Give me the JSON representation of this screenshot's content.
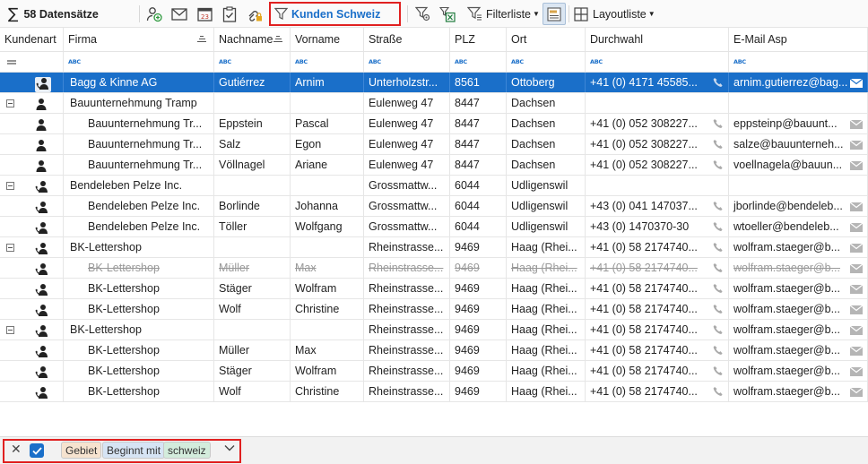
{
  "toolbar": {
    "record_count": "58 Datensätze",
    "active_filter": "Kunden Schweiz",
    "filter_list_label": "Filterliste",
    "layout_list_label": "Layoutliste"
  },
  "grid": {
    "columns": [
      "Kundenart",
      "Firma",
      "Nachname",
      "Vorname",
      "Straße",
      "PLZ",
      "Ort",
      "Durchwahl",
      "E-Mail Asp"
    ],
    "filter_placeholder": "ABC",
    "rows": [
      {
        "type": "detail",
        "icon": "person-phone",
        "firma": "Bagg & Kinne AG",
        "nachname": "Gutiérrez",
        "vorname": "Arnim",
        "strasse": "Unterholzstr...",
        "plz": "8561",
        "ort": "Ottoberg",
        "durchwahl": "+41 (0) 4171 45585...",
        "email": "arnim.gutierrez@bag...",
        "selected": true
      },
      {
        "type": "group",
        "icon": "person",
        "firma": "Bauunternehmung Tramp",
        "nachname": "",
        "vorname": "",
        "strasse": "Eulenweg 47",
        "plz": "8447",
        "ort": "Dachsen",
        "durchwahl": "",
        "email": ""
      },
      {
        "type": "detail",
        "icon": "person",
        "firma": "Bauunternehmung Tr...",
        "nachname": "Eppstein",
        "vorname": "Pascal",
        "strasse": "Eulenweg 47",
        "plz": "8447",
        "ort": "Dachsen",
        "durchwahl": "+41 (0) 052 308227...",
        "email": "eppsteinp@bauunt..."
      },
      {
        "type": "detail",
        "icon": "person",
        "firma": "Bauunternehmung Tr...",
        "nachname": "Salz",
        "vorname": "Egon",
        "strasse": "Eulenweg 47",
        "plz": "8447",
        "ort": "Dachsen",
        "durchwahl": "+41 (0) 052 308227...",
        "email": "salze@bauunterneh..."
      },
      {
        "type": "detail",
        "icon": "person",
        "firma": "Bauunternehmung Tr...",
        "nachname": "Völlnagel",
        "vorname": "Ariane",
        "strasse": "Eulenweg 47",
        "plz": "8447",
        "ort": "Dachsen",
        "durchwahl": "+41 (0) 052 308227...",
        "email": "voellnagela@bauun..."
      },
      {
        "type": "group",
        "icon": "person-phone",
        "firma": "Bendeleben Pelze Inc.",
        "nachname": "",
        "vorname": "",
        "strasse": "Grossmattw...",
        "plz": "6044",
        "ort": "Udligenswil",
        "durchwahl": "",
        "email": ""
      },
      {
        "type": "detail",
        "icon": "person-phone",
        "firma": "Bendeleben Pelze Inc.",
        "nachname": "Borlinde",
        "vorname": "Johanna",
        "strasse": "Grossmattw...",
        "plz": "6044",
        "ort": "Udligenswil",
        "durchwahl": "+43 (0) 041 147037...",
        "email": "jborlinde@bendeleb..."
      },
      {
        "type": "detail",
        "icon": "person-phone",
        "firma": "Bendeleben Pelze Inc.",
        "nachname": "Töller",
        "vorname": "Wolfgang",
        "strasse": "Grossmattw...",
        "plz": "6044",
        "ort": "Udligenswil",
        "durchwahl": "+43 (0) 1470370-30",
        "email": "wtoeller@bendeleb..."
      },
      {
        "type": "group",
        "icon": "person-phone",
        "firma": "BK-Lettershop",
        "nachname": "",
        "vorname": "",
        "strasse": "Rheinstrasse...",
        "plz": "9469",
        "ort": "Haag (Rhei...",
        "durchwahl": "+41 (0) 58 2174740...",
        "email": "wolfram.staeger@b..."
      },
      {
        "type": "detail",
        "icon": "person-phone",
        "firma": "BK-Lettershop",
        "nachname": "Müller",
        "vorname": "Max",
        "strasse": "Rheinstrasse...",
        "plz": "9469",
        "ort": "Haag (Rhei...",
        "durchwahl": "+41 (0) 58 2174740...",
        "email": "wolfram.staeger@b...",
        "strike": true
      },
      {
        "type": "detail",
        "icon": "person-phone",
        "firma": "BK-Lettershop",
        "nachname": "Stäger",
        "vorname": "Wolfram",
        "strasse": "Rheinstrasse...",
        "plz": "9469",
        "ort": "Haag (Rhei...",
        "durchwahl": "+41 (0) 58 2174740...",
        "email": "wolfram.staeger@b..."
      },
      {
        "type": "detail",
        "icon": "person-phone",
        "firma": "BK-Lettershop",
        "nachname": "Wolf",
        "vorname": "Christine",
        "strasse": "Rheinstrasse...",
        "plz": "9469",
        "ort": "Haag (Rhei...",
        "durchwahl": "+41 (0) 58 2174740...",
        "email": "wolfram.staeger@b..."
      },
      {
        "type": "group",
        "icon": "person-phone",
        "firma": "BK-Lettershop",
        "nachname": "",
        "vorname": "",
        "strasse": "Rheinstrasse...",
        "plz": "9469",
        "ort": "Haag (Rhei...",
        "durchwahl": "+41 (0) 58 2174740...",
        "email": "wolfram.staeger@b..."
      },
      {
        "type": "detail",
        "icon": "person-phone",
        "firma": "BK-Lettershop",
        "nachname": "Müller",
        "vorname": "Max",
        "strasse": "Rheinstrasse...",
        "plz": "9469",
        "ort": "Haag (Rhei...",
        "durchwahl": "+41 (0) 58 2174740...",
        "email": "wolfram.staeger@b..."
      },
      {
        "type": "detail",
        "icon": "person-phone",
        "firma": "BK-Lettershop",
        "nachname": "Stäger",
        "vorname": "Wolfram",
        "strasse": "Rheinstrasse...",
        "plz": "9469",
        "ort": "Haag (Rhei...",
        "durchwahl": "+41 (0) 58 2174740...",
        "email": "wolfram.staeger@b..."
      },
      {
        "type": "detail",
        "icon": "person-phone",
        "firma": "BK-Lettershop",
        "nachname": "Wolf",
        "vorname": "Christine",
        "strasse": "Rheinstrasse...",
        "plz": "9469",
        "ort": "Haag (Rhei...",
        "durchwahl": "+41 (0) 58 2174740...",
        "email": "wolfram.staeger@b..."
      }
    ]
  },
  "filter_bar": {
    "chips": [
      "Gebiet",
      "Beginnt mit",
      "schweiz"
    ],
    "chip_colors": [
      "#f6e3cf",
      "#d6e4f4",
      "#d3ecdc"
    ]
  },
  "colors": {
    "accent": "#1a6fc9",
    "highlight_border": "#e02020"
  }
}
